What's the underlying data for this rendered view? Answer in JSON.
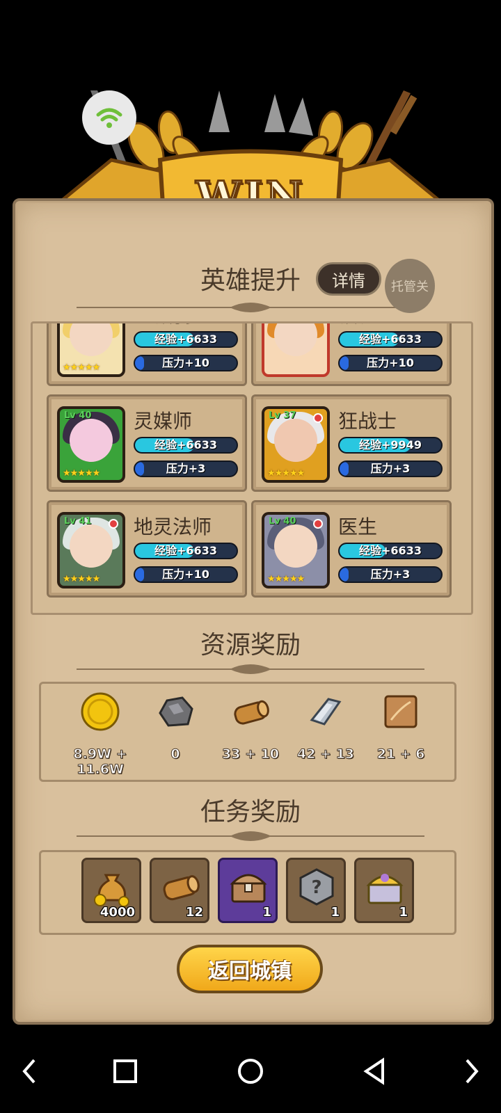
{
  "banner": {
    "title": "WIN"
  },
  "status": {
    "wifi_icon": "wifi-icon"
  },
  "hero_section": {
    "title": "英雄提升",
    "detail_label": "详情",
    "auto_label": "托管关",
    "heroes": [
      {
        "name": "圣殿骑士",
        "level": "",
        "exp": "经验+6633",
        "pressure": "压力+10",
        "stars": "★★★★★",
        "frame": "#2b2b2b",
        "hair": "#f1cf6a"
      },
      {
        "name": "镇长",
        "level": "",
        "exp": "经验+6633",
        "pressure": "压力+10",
        "stars": "",
        "frame": "#c0392b",
        "hair": "#e08a2a"
      },
      {
        "name": "灵媒师",
        "level": "Lv 40",
        "exp": "经验+6633",
        "pressure": "压力+3",
        "stars": "★★★★★",
        "frame": "#3aa33a",
        "hair": "#3a2f45"
      },
      {
        "name": "狂战士",
        "level": "Lv 37",
        "exp": "经验+9949",
        "pressure": "压力+3",
        "stars": "★★★★★",
        "frame": "#e0a020",
        "hair": "#e8e8ea"
      },
      {
        "name": "地灵法师",
        "level": "Lv 41",
        "exp": "经验+6633",
        "pressure": "压力+10",
        "stars": "★★★★★",
        "frame": "#2b2b2b",
        "hair": "#dfe6e3"
      },
      {
        "name": "医生",
        "level": "Lv 40",
        "exp": "经验+6633",
        "pressure": "压力+3",
        "stars": "★★★★★",
        "frame": "#2b2b2b",
        "hair": "#5a5e78"
      }
    ]
  },
  "resource_section": {
    "title": "资源奖励",
    "items": [
      {
        "icon": "gold-coin-icon",
        "value": "8.9W + 11.6W"
      },
      {
        "icon": "stone-icon",
        "value": "0"
      },
      {
        "icon": "wood-log-icon",
        "value": "33 + 10"
      },
      {
        "icon": "iron-ingot-icon",
        "value": "42 + 13"
      },
      {
        "icon": "leather-icon",
        "value": "21 + 6"
      }
    ]
  },
  "task_section": {
    "title": "任务奖励",
    "items": [
      {
        "icon": "money-bag-icon",
        "count": "4000"
      },
      {
        "icon": "wood-log-icon",
        "count": "12"
      },
      {
        "icon": "treasure-chest-icon",
        "count": "1"
      },
      {
        "icon": "mystery-gem-icon",
        "count": "1"
      },
      {
        "icon": "golden-chest-icon",
        "count": "1"
      }
    ]
  },
  "return_button": "返回城镇",
  "nav": [
    "back-arrow-icon",
    "recents-icon",
    "home-icon",
    "back-triangle-icon",
    "forward-arrow-icon"
  ]
}
